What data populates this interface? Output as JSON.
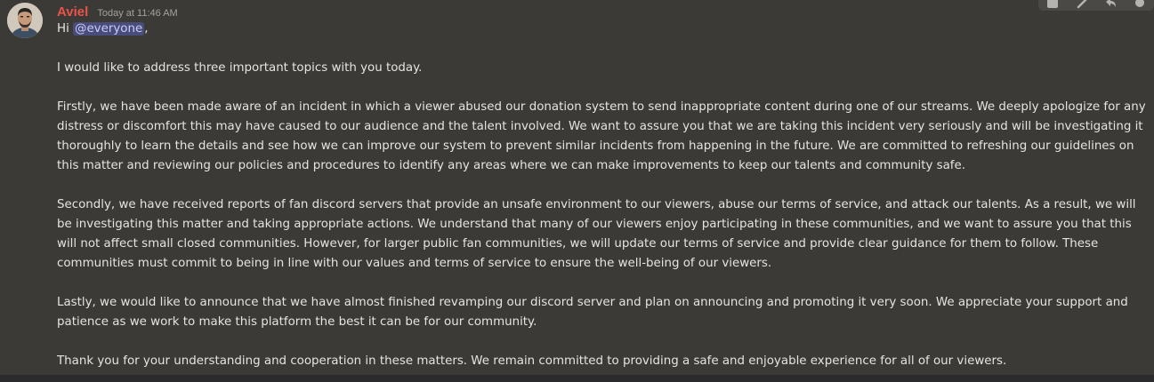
{
  "message": {
    "author": "Aviel",
    "timestamp": "Today at 11:46 AM",
    "greeting_prefix": "Hi ",
    "mention": "@everyone",
    "greeting_suffix": ",",
    "paragraphs": [
      "I would like to address three important topics with you today.",
      "Firstly, we have been made aware of an incident in which a viewer abused our donation system to send inappropriate content during one of our streams. We deeply apologize for any distress or discomfort this may have caused to our audience and the talent involved. We want to assure you that we are taking this incident very seriously and will be investigating it thoroughly to learn the details and see how we can improve our system to prevent similar incidents from happening in the future. We are committed to refreshing our guidelines on this matter and reviewing our policies and procedures to identify any areas where we can make improvements to keep our talents and community safe.",
      "Secondly, we have received reports of fan discord servers that provide an unsafe environment to our viewers, abuse our terms of service, and attack our talents. As a result, we will be investigating this matter and taking appropriate actions. We understand that many of our viewers enjoy participating in these communities, and we want to assure you that this will not affect small closed communities. However, for larger public fan communities, we will update our terms of service and provide clear guidance for them to follow. These communities must commit to being in line with our values and terms of service to ensure the well-being of our viewers.",
      "Lastly, we would like to announce that we have almost finished revamping our discord server and plan on announcing and promoting it very soon. We appreciate your support and patience as we work to make this platform the best it can be for our community.",
      "Thank you for your understanding and cooperation in these matters. We remain committed to providing a safe and enjoyable experience for all of our viewers."
    ]
  },
  "toolbar": {
    "icons": [
      "add-reaction-icon",
      "link-icon",
      "reply-icon",
      "more-icon"
    ]
  },
  "colors": {
    "background": "#3b3a36",
    "username": "#e8534a",
    "text": "#e6e4df",
    "mention_bg": "#4a4d7a",
    "mention_text": "#c9cdfb"
  }
}
